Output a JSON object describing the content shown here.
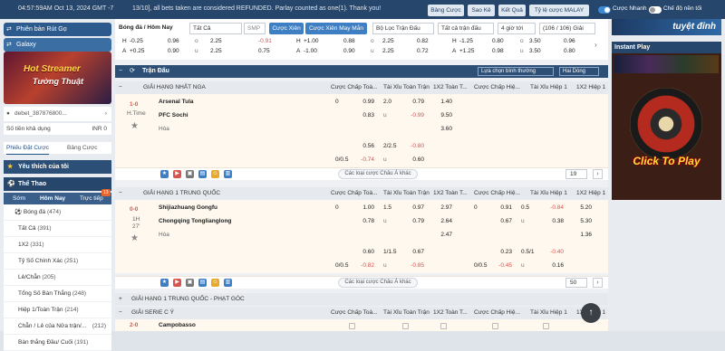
{
  "topbar": {
    "clock": "04:57:59AM Oct 13, 2024 GMT -7",
    "ticker": "13/10], all bets taken are considered REFUNDED. Parlay counted as one(1). Thank you!",
    "buttons": [
      "Bảng Cược",
      "Sao Kê",
      "Kết Quả",
      "Tỷ lệ cược MALAY"
    ],
    "fast_bet": "Cược Nhanh",
    "night_mode": "Chế độ nền tối"
  },
  "sidebar": {
    "promo1": "Phiên bản Rút Gọ",
    "promo2": "Galaxy",
    "banner_line1": "Hot Streamer",
    "banner_line2": "Tường Thuật",
    "username": "debet_387876800...",
    "balance_label": "Số tiền khả dụng",
    "balance_value": "INR 0",
    "slip_tabs": [
      "Phiếu Đặt Cược",
      "Bảng Cược"
    ],
    "favorites": "Yêu thích của tôi",
    "sports": "Thể Thao",
    "sport_tabs": [
      "Sớm",
      "Hôm Nay",
      "Trực tiếp"
    ],
    "live_badge": "13",
    "nav": [
      {
        "label": "Bóng đá",
        "count": "(474)"
      },
      {
        "label": "Tất Cả",
        "count": "(391)"
      },
      {
        "label": "1X2",
        "count": "(331)"
      },
      {
        "label": "Tỷ Số Chính Xác",
        "count": "(251)"
      },
      {
        "label": "Lẻ/Chẵn",
        "count": "(205)"
      },
      {
        "label": "Tổng Số Bàn Thắng",
        "count": "(248)"
      },
      {
        "label": "Hiệp 1/Toàn Trận",
        "count": "(214)"
      },
      {
        "label": "Chẵn / Lẻ của Nửa trận/...",
        "count": "(212)"
      },
      {
        "label": "Bàn thắng Đầu/ Cuối",
        "count": "(191)"
      }
    ]
  },
  "filter": {
    "breadcrumb": "Bóng đá / Hôm Nay",
    "all": "Tất Cả",
    "smp": "SMP",
    "bet_btn": "Cược Xiên",
    "bet_btn2": "Cược Xiên May Mắn",
    "league_filter": "Bộ Lọc Trận Đấu",
    "all_matches": "Tất cả trận đấu",
    "hours": "4 giờ tới",
    "count": "(106 / 106) Giải"
  },
  "mini": [
    {
      "rows": [
        [
          "H",
          "-0.25",
          "0.96",
          "o",
          "2.25",
          "-0.91"
        ],
        [
          "A",
          "+0.25",
          "0.90",
          "u",
          "2.25",
          "0.75"
        ]
      ]
    },
    {
      "rows": [
        [
          "H",
          "+1.00",
          "0.88",
          "o",
          "2.25",
          "0.82"
        ],
        [
          "A",
          "-1.00",
          "0.90",
          "u",
          "2.25",
          "0.72"
        ]
      ]
    },
    {
      "rows": [
        [
          "H",
          "-1.25",
          "0.80",
          "o",
          "3.50",
          "0.96"
        ],
        [
          "A",
          "+1.25",
          "0.98",
          "u",
          "3.50",
          "0.80"
        ]
      ]
    }
  ],
  "panel": {
    "title": "Trận Đấu",
    "sort": "Lựa chọn bình thường",
    "halves": "Hai Dòng"
  },
  "col_headers": [
    "Cược Chấp Toà...",
    "Tài Xỉu Toàn Trận",
    "1X2 Toàn T...",
    "Cược Chấp Hiệ...",
    "Tài Xỉu Hiệp 1",
    "1X2 Hiệp 1"
  ],
  "leagues": [
    "GIẢI HẠNG NHẤT NGA",
    "GIẢI HẠNG 1 TRUNG QUỐC",
    "GIẢI HẠNG 1 TRUNG QUỐC - PHẠT GÓC",
    "GIẢI SERIE C Ý"
  ],
  "match1": {
    "score": "1-0",
    "status": "H.Time",
    "home": "Arsenal Tula",
    "away": "PFC Sochi",
    "draw": "Hòa",
    "r1": [
      "0",
      "0.99",
      "2.0",
      "0.79",
      "1.40"
    ],
    "r2": [
      "0.83",
      "u",
      "-0.99",
      "9.50"
    ],
    "r3": [
      "3.60"
    ],
    "r4": [
      "0.56",
      "2/2.5",
      "-0.80"
    ],
    "r5": [
      "0/0.5",
      "-0.74",
      "u",
      "0.60"
    ],
    "pager": "19"
  },
  "match2": {
    "score": "0-0",
    "status": "1H",
    "minute": "27'",
    "home": "Shijiazhuang Gongfu",
    "away": "Chongqing Tonglianglong",
    "draw": "Hòa",
    "r1": [
      "0",
      "1.00",
      "1.5",
      "0.97",
      "2.97",
      "0",
      "0.91",
      "0.5",
      "-0.84",
      "5.20"
    ],
    "r2": [
      "0.78",
      "u",
      "0.79",
      "2.64",
      "0.67",
      "u",
      "0.38",
      "5.30"
    ],
    "r3": [
      "2.47",
      "1.36"
    ],
    "r4": [
      "0.60",
      "1/1.5",
      "0.67",
      "0.23",
      "0.5/1",
      "-0.40"
    ],
    "r5": [
      "0/0.5",
      "-0.82",
      "u",
      "-0.85",
      "0/0.5",
      "-0.45",
      "u",
      "0.16"
    ],
    "pager": "50"
  },
  "match3": {
    "score": "2-0",
    "home": "Campobasso"
  },
  "more": "Các loại cược Châu Á khác",
  "right": {
    "banner": "tuyệt đỉnh",
    "header": "Instant Play",
    "game_label": "Click To Play"
  }
}
